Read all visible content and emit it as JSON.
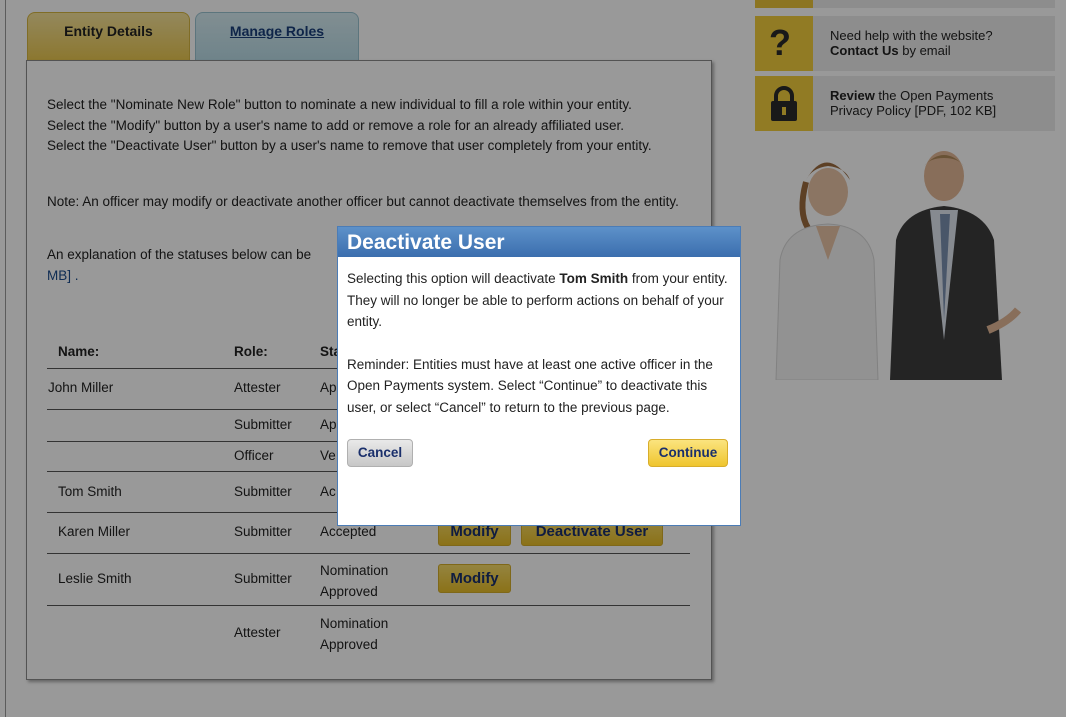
{
  "tabs": {
    "entity_details": "Entity Details",
    "manage_roles": "Manage Roles"
  },
  "instructions": {
    "line1": "Select the \"Nominate New Role\" button to nominate a new individual to fill a role within your entity.",
    "line2": "Select the \"Modify\" button by a user's name to add or remove a role for an already affiliated user.",
    "line3": "Select the \"Deactivate User\" button by a user's name to remove that user completely from your entity.",
    "note": "Note: An officer may modify or deactivate another officer but cannot deactivate themselves from the entity.",
    "explanation_visible": "An explanation of the statuses below can be",
    "explanation_link_tail": "MB] ."
  },
  "table": {
    "headers": {
      "name": "Name:",
      "role": "Role:",
      "status": "Sta"
    },
    "rows": [
      {
        "name": "John Miller",
        "role": "Attester",
        "status": "Ap"
      },
      {
        "name": "",
        "role": "Submitter",
        "status": "Ap"
      },
      {
        "name": "",
        "role": "Officer",
        "status": "Ve"
      },
      {
        "name": "Tom Smith",
        "role": "Submitter",
        "status": "Ac"
      },
      {
        "name": "Karen Miller",
        "role": "Submitter",
        "status": "Accepted",
        "modify": "Modify",
        "deactivate": "Deactivate User"
      },
      {
        "name": "Leslie Smith",
        "role": "Submitter",
        "status_line1": "Nomination",
        "status_line2": "Approved",
        "modify": "Modify"
      },
      {
        "name": "",
        "role": "Attester",
        "status_line1": "Nomination",
        "status_line2": "Approved"
      }
    ]
  },
  "sidebar": {
    "help": {
      "icon": "question-icon",
      "line1": "Need help with the website?",
      "line2_bold": "Contact Us",
      "line2_rest": " by email"
    },
    "privacy": {
      "icon": "lock-icon",
      "line1_bold": "Review",
      "line1_rest": " the Open Payments",
      "line2": "Privacy Policy [PDF, 102 KB]"
    }
  },
  "modal": {
    "title": "Deactivate User",
    "para1_pre": "Selecting this option will deactivate ",
    "para1_name": "Tom Smith",
    "para1_post": " from your entity. They will no longer be able to perform actions on behalf of your entity.",
    "para2": "Reminder: Entities must have at least one active officer in the Open Payments system. Select “Continue” to deactivate this user, or select “Cancel” to return to the previous page.",
    "cancel": "Cancel",
    "continue": "Continue"
  }
}
